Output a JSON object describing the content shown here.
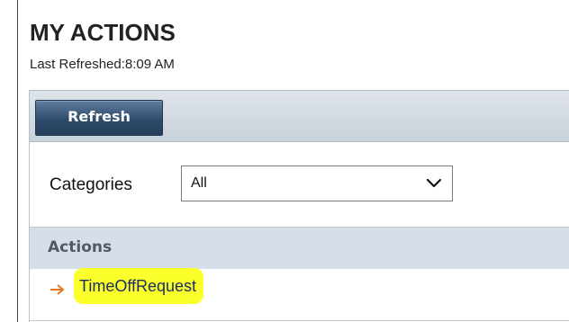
{
  "header": {
    "title": "MY ACTIONS",
    "last_refreshed": "Last Refreshed:8:09 AM"
  },
  "toolbar": {
    "refresh_label": "Refresh"
  },
  "filters": {
    "categories_label": "Categories",
    "categories_selected": "All"
  },
  "actions": {
    "header_label": "Actions",
    "items": [
      {
        "label": "TimeOffRequest",
        "icon": "arrow-right-icon",
        "highlight_color": "#fbff2a"
      }
    ]
  },
  "colors": {
    "button_top": "#5f7d9e",
    "button_bottom": "#263e5b",
    "toolbar_bg": "#c9d1da",
    "actions_header_bg": "#d6dee8",
    "arrow": "#e8741f",
    "link_text": "#1c2e66"
  }
}
